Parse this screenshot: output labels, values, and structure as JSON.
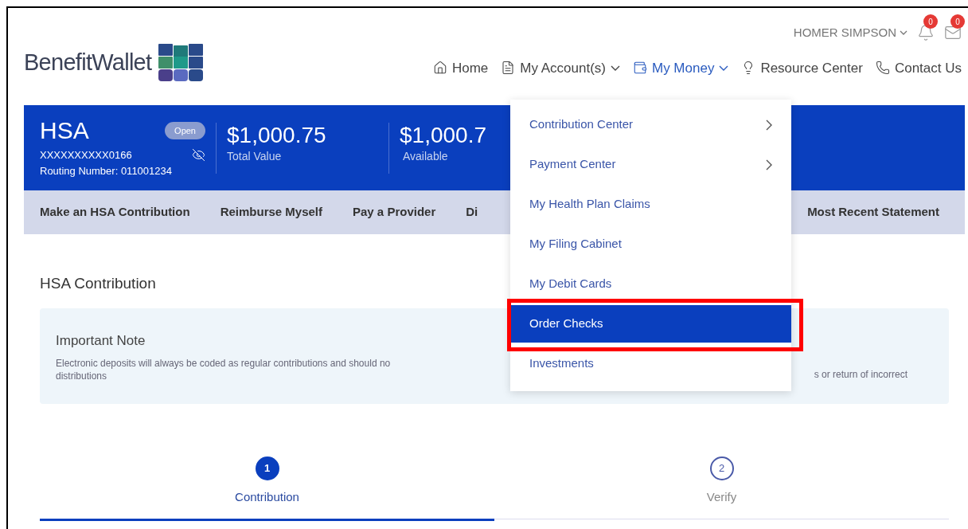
{
  "header": {
    "logo": "BenefitWallet",
    "user": "HOMER SIMPSON",
    "notifications_badge": "0",
    "messages_badge": "0",
    "nav": [
      {
        "label": "Home",
        "dropdown": false,
        "selected": false
      },
      {
        "label": "My Account(s)",
        "dropdown": true,
        "selected": false
      },
      {
        "label": "My Money",
        "dropdown": true,
        "selected": true
      },
      {
        "label": "Resource Center",
        "dropdown": false,
        "selected": false
      },
      {
        "label": "Contact Us",
        "dropdown": false,
        "selected": false
      }
    ]
  },
  "account": {
    "type": "HSA",
    "status": "Open",
    "number": "XXXXXXXXXX0166",
    "routing": "Routing Number: 011001234",
    "balances": [
      {
        "amount": "$1,000.75",
        "label": "Total Value"
      },
      {
        "amount": "$1,000.7",
        "label": "Available"
      }
    ]
  },
  "actions": [
    "Make an HSA Contribution",
    "Reimburse Myself",
    "Pay a Provider",
    "Di",
    "Most Recent Statement"
  ],
  "page": {
    "title": "HSA Contribution",
    "note": {
      "title": "Important Note",
      "text_left": [
        "Electronic deposits will always be coded as regular contributions and should no",
        "distributions"
      ],
      "text_right": "s or return of incorrect"
    }
  },
  "steps": [
    {
      "number": "1",
      "label": "Contribution",
      "selected": true
    },
    {
      "number": "2",
      "label": "Verify",
      "selected": false
    }
  ],
  "menu": {
    "items": [
      {
        "label": "Contribution Center",
        "submenu": true,
        "selected": false,
        "highlighted": false
      },
      {
        "label": "Payment Center",
        "submenu": true,
        "selected": false,
        "highlighted": false
      },
      {
        "label": "My Health Plan Claims",
        "submenu": false,
        "selected": false,
        "highlighted": false
      },
      {
        "label": "My Filing Cabinet",
        "submenu": false,
        "selected": false,
        "highlighted": false
      },
      {
        "label": "My Debit Cards",
        "submenu": false,
        "selected": false,
        "highlighted": false
      },
      {
        "label": "Order Checks",
        "submenu": false,
        "selected": true,
        "highlighted": true
      },
      {
        "label": "Investments",
        "submenu": false,
        "selected": false,
        "highlighted": false
      }
    ]
  }
}
